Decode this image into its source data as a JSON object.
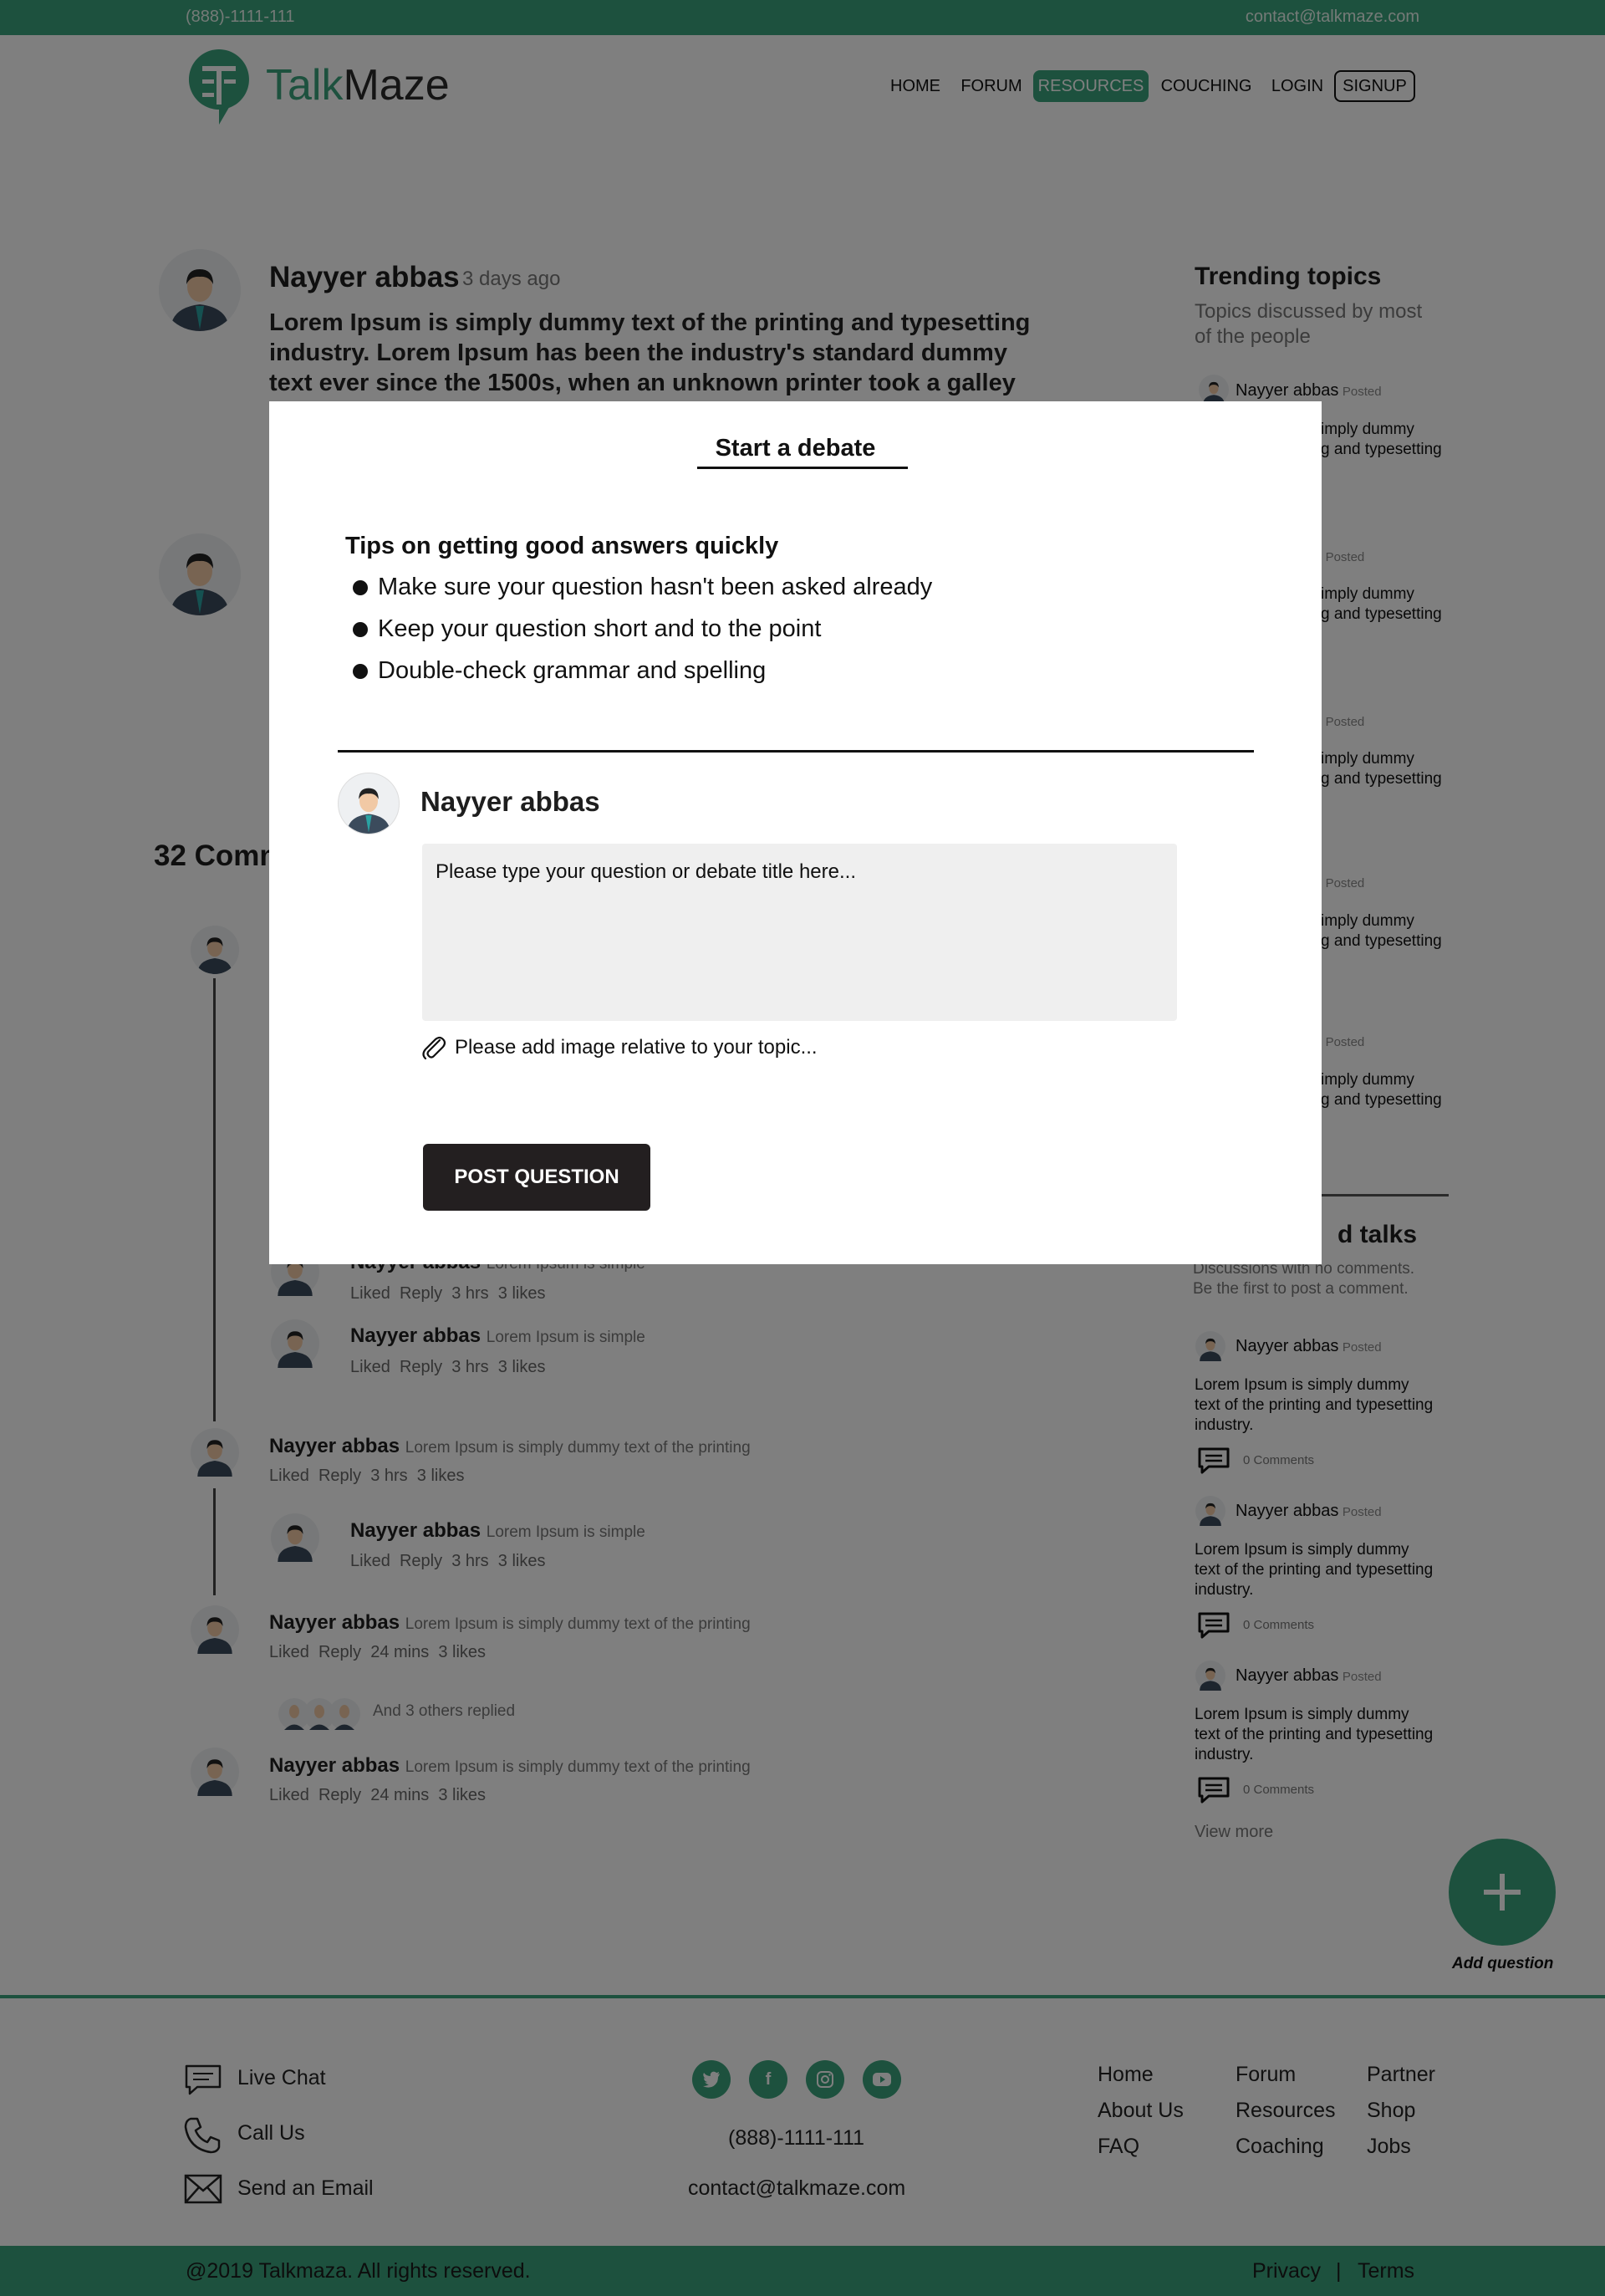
{
  "topbar": {
    "phone": "(888)-1111-111",
    "email": "contact@talkmaze.com"
  },
  "brand": {
    "part1": "Talk",
    "part2": "Maze",
    "accent": "#3aa37c"
  },
  "nav": [
    "HOME",
    "FORUM",
    "RESOURCES",
    "COUCHING",
    "LOGIN",
    "SIGNUP"
  ],
  "post": {
    "author": "Nayyer abbas",
    "time": "3 days ago",
    "text_lines": [
      "Lorem Ipsum is simply dummy text of the printing and typesetting",
      "industry. Lorem Ipsum has been the industry's standard dummy",
      "text ever since the 1500s, when an unknown printer took a galley"
    ]
  },
  "comments_heading": "32 Comm",
  "comments": [
    {
      "name": "Nayyer abbas",
      "text": "Lorem Ipsum is simple",
      "actions": [
        "Liked",
        "Reply",
        "3 hrs",
        "3 likes"
      ]
    },
    {
      "name": "Nayyer abbas",
      "text": "Lorem Ipsum is simple",
      "actions": [
        "Liked",
        "Reply",
        "3 hrs",
        "3 likes"
      ]
    },
    {
      "name": "Nayyer abbas",
      "text": "Lorem Ipsum is simply dummy text of the printing",
      "actions": [
        "Liked",
        "Reply",
        "3 hrs",
        "3 likes"
      ]
    },
    {
      "name": "Nayyer abbas",
      "text": "Lorem Ipsum is simple",
      "actions": [
        "Liked",
        "Reply",
        "3 hrs",
        "3 likes"
      ]
    },
    {
      "name": "Nayyer abbas",
      "text": "Lorem Ipsum is simply dummy text of the printing",
      "actions": [
        "Liked",
        "Reply",
        "24 mins",
        "3 likes"
      ]
    },
    {
      "name": "Nayyer abbas",
      "text": "Lorem Ipsum is simply dummy text of the printing",
      "actions": [
        "Liked",
        "Reply",
        "24 mins",
        "3 likes"
      ]
    }
  ],
  "replied_note": "And 3 others replied",
  "sidebar": {
    "trending_title": "Trending topics",
    "trending_sub": [
      "Topics discussed by most",
      "of the people"
    ],
    "trending_items": [
      {
        "name": "Nayyer abbas",
        "tag": "Posted",
        "lines": [
          "imply dummy",
          "g and typesetting"
        ]
      },
      {
        "name": "as",
        "tag": "Posted",
        "lines": [
          "imply dummy",
          "g and typesetting"
        ]
      },
      {
        "name": "as",
        "tag": "Posted",
        "lines": [
          "imply dummy",
          "g and typesetting"
        ]
      },
      {
        "name": "as",
        "tag": "Posted",
        "lines": [
          "imply dummy",
          "g and typesetting"
        ]
      },
      {
        "name": "as",
        "tag": "Posted",
        "lines": [
          "imply dummy",
          "g and typesetting"
        ]
      }
    ],
    "unanswered_title": "d talks",
    "unanswered_sub": [
      "Discussions with no comments.",
      "Be the first to post a comment."
    ],
    "unanswered_items": [
      {
        "name": "Nayyer abbas",
        "tag": "Posted",
        "lines": [
          "Lorem Ipsum is simply dummy",
          "text of the printing and typesetting",
          "industry."
        ],
        "comments": "0 Comments"
      },
      {
        "name": "Nayyer abbas",
        "tag": "Posted",
        "lines": [
          "Lorem Ipsum is simply dummy",
          "text of the printing and typesetting",
          "industry."
        ],
        "comments": "0 Comments"
      },
      {
        "name": "Nayyer abbas",
        "tag": "Posted",
        "lines": [
          "Lorem Ipsum is simply dummy",
          "text of the printing and typesetting",
          "industry."
        ],
        "comments": "0 Comments"
      }
    ],
    "view_more": "View more"
  },
  "fab_label": "Add question",
  "footer": {
    "contact": [
      "Live Chat",
      "Call Us",
      "Send an Email"
    ],
    "phone": "(888)-1111-111",
    "email": "contact@talkmaze.com",
    "social": [
      "twitter-icon",
      "facebook-icon",
      "instagram-icon",
      "youtube-icon"
    ],
    "col1": [
      "Home",
      "About Us",
      "FAQ"
    ],
    "col2": [
      "Forum",
      "Resources",
      "Coaching"
    ],
    "col3": [
      "Partner",
      "Shop",
      "Jobs"
    ],
    "copyright": "@2019 Talkmaza. All rights reserved.",
    "privacy": "Privacy",
    "sep": "|",
    "terms": "Terms"
  },
  "modal": {
    "title": "Start a debate",
    "tips_title": "Tips on getting good answers quickly",
    "tips": [
      "Make sure your question hasn't been asked already",
      "Keep your question short and to the point",
      "Double-check grammar and spelling"
    ],
    "user": "Nayyer abbas",
    "question_placeholder": "Please type your question or debate title here...",
    "attach_label": "Please add image relative to your topic...",
    "post_button": "POST QUESTION"
  }
}
